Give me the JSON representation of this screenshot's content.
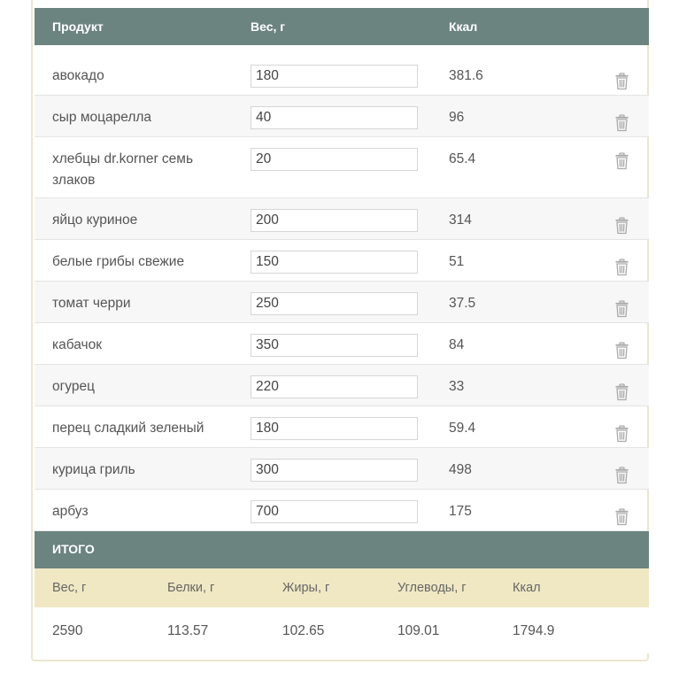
{
  "header": {
    "product": "Продукт",
    "weight": "Вес, г",
    "kcal": "Ккал"
  },
  "rows": [
    {
      "name": "авокадо",
      "weight": "180",
      "kcal": "381.6"
    },
    {
      "name": "сыр моцарелла",
      "weight": "40",
      "kcal": "96"
    },
    {
      "name": "хлебцы dr.korner семь злаков",
      "weight": "20",
      "kcal": "65.4"
    },
    {
      "name": "яйцо куриное",
      "weight": "200",
      "kcal": "314"
    },
    {
      "name": "белые грибы свежие",
      "weight": "150",
      "kcal": "51"
    },
    {
      "name": "томат черри",
      "weight": "250",
      "kcal": "37.5"
    },
    {
      "name": "кабачок",
      "weight": "350",
      "kcal": "84"
    },
    {
      "name": "огурец",
      "weight": "220",
      "kcal": "33"
    },
    {
      "name": "перец сладкий зеленый",
      "weight": "180",
      "kcal": "59.4"
    },
    {
      "name": "курица гриль",
      "weight": "300",
      "kcal": "498"
    },
    {
      "name": "арбуз",
      "weight": "700",
      "kcal": "175"
    }
  ],
  "total": {
    "title": "ИТОГО",
    "headers": {
      "weight": "Вес, г",
      "protein": "Белки, г",
      "fat": "Жиры, г",
      "carbs": "Углеводы, г",
      "kcal": "Ккал"
    },
    "values": {
      "weight": "2590",
      "protein": "113.57",
      "fat": "102.65",
      "carbs": "109.01",
      "kcal": "1794.9"
    }
  },
  "colors": {
    "header_bg": "#6b8480",
    "summary_bg": "#efe8c3",
    "row_alt": "#f7f7f7"
  },
  "icons": {
    "delete": "trash-icon"
  }
}
